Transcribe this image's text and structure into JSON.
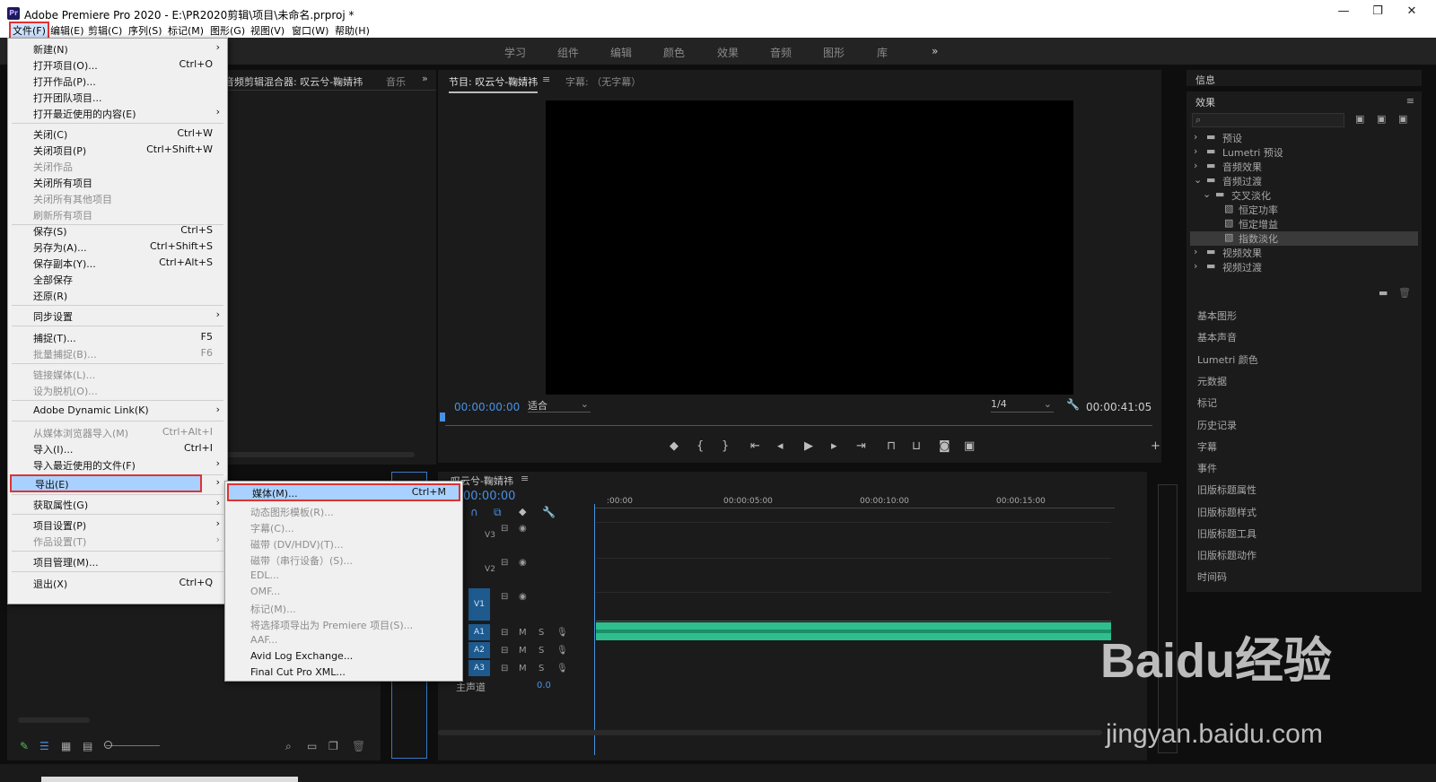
{
  "window": {
    "title": "Adobe Premiere Pro 2020 - E:\\PR2020剪辑\\项目\\未命名.prproj *",
    "logo": "Pr",
    "controls": [
      "—",
      "❐",
      "✕"
    ]
  },
  "menubar": [
    "文件(F)",
    "编辑(E)",
    "剪辑(C)",
    "序列(S)",
    "标记(M)",
    "图形(G)",
    "视图(V)",
    "窗口(W)",
    "帮助(H)"
  ],
  "workspaces": [
    "学习",
    "组件",
    "编辑",
    "颜色",
    "效果",
    "音频",
    "图形",
    "库",
    "»"
  ],
  "file_menu": [
    {
      "label": "新建(N)",
      "shortcut": "",
      "arrow": "›",
      "disabled": false
    },
    {
      "label": "打开项目(O)...",
      "shortcut": "Ctrl+O",
      "arrow": "",
      "disabled": false
    },
    {
      "label": "打开作品(P)...",
      "shortcut": "",
      "arrow": "",
      "disabled": false
    },
    {
      "label": "打开团队项目...",
      "shortcut": "",
      "arrow": "",
      "disabled": false
    },
    {
      "label": "打开最近使用的内容(E)",
      "shortcut": "",
      "arrow": "›",
      "disabled": false
    },
    {
      "label": "关闭(C)",
      "shortcut": "Ctrl+W",
      "arrow": "",
      "disabled": false
    },
    {
      "label": "关闭项目(P)",
      "shortcut": "Ctrl+Shift+W",
      "arrow": "",
      "disabled": false
    },
    {
      "label": "关闭作品",
      "shortcut": "",
      "arrow": "",
      "disabled": true
    },
    {
      "label": "关闭所有项目",
      "shortcut": "",
      "arrow": "",
      "disabled": false
    },
    {
      "label": "关闭所有其他项目",
      "shortcut": "",
      "arrow": "",
      "disabled": true
    },
    {
      "label": "刷新所有项目",
      "shortcut": "",
      "arrow": "",
      "disabled": true
    },
    {
      "label": "保存(S)",
      "shortcut": "Ctrl+S",
      "arrow": "",
      "disabled": false
    },
    {
      "label": "另存为(A)...",
      "shortcut": "Ctrl+Shift+S",
      "arrow": "",
      "disabled": false
    },
    {
      "label": "保存副本(Y)...",
      "shortcut": "Ctrl+Alt+S",
      "arrow": "",
      "disabled": false
    },
    {
      "label": "全部保存",
      "shortcut": "",
      "arrow": "",
      "disabled": false
    },
    {
      "label": "还原(R)",
      "shortcut": "",
      "arrow": "",
      "disabled": false
    },
    {
      "label": "同步设置",
      "shortcut": "",
      "arrow": "›",
      "disabled": false
    },
    {
      "label": "捕捉(T)...",
      "shortcut": "F5",
      "arrow": "",
      "disabled": false
    },
    {
      "label": "批量捕捉(B)...",
      "shortcut": "F6",
      "arrow": "",
      "disabled": true
    },
    {
      "label": "链接媒体(L)...",
      "shortcut": "",
      "arrow": "",
      "disabled": true
    },
    {
      "label": "设为脱机(O)...",
      "shortcut": "",
      "arrow": "",
      "disabled": true
    },
    {
      "label": "Adobe Dynamic Link(K)",
      "shortcut": "",
      "arrow": "›",
      "disabled": false
    },
    {
      "label": "从媒体浏览器导入(M)",
      "shortcut": "Ctrl+Alt+I",
      "arrow": "",
      "disabled": true
    },
    {
      "label": "导入(I)...",
      "shortcut": "Ctrl+I",
      "arrow": "",
      "disabled": false
    },
    {
      "label": "导入最近使用的文件(F)",
      "shortcut": "",
      "arrow": "›",
      "disabled": false
    },
    {
      "label": "导出(E)",
      "shortcut": "",
      "arrow": "›",
      "disabled": false,
      "highlight": true
    },
    {
      "label": "获取属性(G)",
      "shortcut": "",
      "arrow": "›",
      "disabled": false
    },
    {
      "label": "项目设置(P)",
      "shortcut": "",
      "arrow": "›",
      "disabled": false
    },
    {
      "label": "作品设置(T)",
      "shortcut": "",
      "arrow": "›",
      "disabled": true
    },
    {
      "label": "项目管理(M)...",
      "shortcut": "",
      "arrow": "",
      "disabled": false
    },
    {
      "label": "退出(X)",
      "shortcut": "Ctrl+Q",
      "arrow": "",
      "disabled": false
    }
  ],
  "export_menu": [
    {
      "label": "媒体(M)...",
      "shortcut": "Ctrl+M",
      "disabled": false,
      "highlight": true
    },
    {
      "label": "动态图形模板(R)...",
      "shortcut": "",
      "disabled": true
    },
    {
      "label": "字幕(C)...",
      "shortcut": "",
      "disabled": true
    },
    {
      "label": "磁带 (DV/HDV)(T)...",
      "shortcut": "",
      "disabled": true
    },
    {
      "label": "磁带（串行设备）(S)...",
      "shortcut": "",
      "disabled": true
    },
    {
      "label": "EDL...",
      "shortcut": "",
      "disabled": true
    },
    {
      "label": "OMF...",
      "shortcut": "",
      "disabled": true
    },
    {
      "label": "标记(M)...",
      "shortcut": "",
      "disabled": true
    },
    {
      "label": "将选择项导出为 Premiere 项目(S)...",
      "shortcut": "",
      "disabled": true
    },
    {
      "label": "AAF...",
      "shortcut": "",
      "disabled": true
    },
    {
      "label": "Avid Log Exchange...",
      "shortcut": "",
      "disabled": false
    },
    {
      "label": "Final Cut Pro XML...",
      "shortcut": "",
      "disabled": false
    }
  ],
  "source_panel": {
    "tab1": "音频剪辑混合器: 叹云兮-鞠婧祎",
    "tab2": "音乐"
  },
  "program_monitor": {
    "tab": "节目: 叹云兮-鞠婧祎",
    "tab2": "字幕: （无字幕）",
    "timecode": "00:00:00:00",
    "fit": "适合",
    "resolution": "1/4",
    "duration": "00:00:41:05"
  },
  "timeline": {
    "tab": "叹云兮-鞠婧祎",
    "timecode": "00:00:00",
    "ruler": [
      ":00:00",
      "00:00:05:00",
      "00:00:10:00",
      "00:00:15:00"
    ],
    "tracks": [
      "V3",
      "V2",
      "V1",
      "A1",
      "A2",
      "A3"
    ],
    "master": "主声道",
    "master_value": "0.0"
  },
  "info_panel": {
    "title": "信息"
  },
  "effects_panel": {
    "title": "效果",
    "tree": [
      "预设",
      "Lumetri 预设",
      "音频效果",
      "音频过渡",
      "交叉淡化",
      "恒定功率",
      "恒定增益",
      "指数淡化",
      "视频效果",
      "视频过渡"
    ]
  },
  "side_panels": [
    "基本图形",
    "基本声音",
    "Lumetri 颜色",
    "元数据",
    "标记",
    "历史记录",
    "字幕",
    "事件",
    "旧版标题属性",
    "旧版标题样式",
    "旧版标题工具",
    "旧版标题动作",
    "时间码"
  ],
  "watermark": {
    "brand": "Baidu经验",
    "url": "jingyan.baidu.com"
  }
}
